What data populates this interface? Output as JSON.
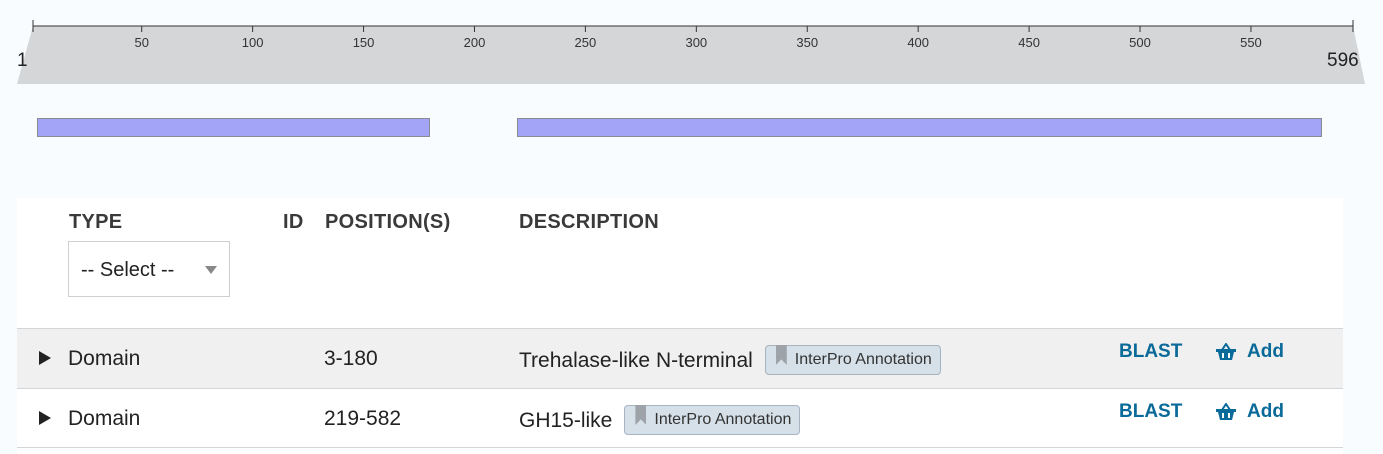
{
  "ruler": {
    "start": "1",
    "end": "596",
    "ticks": [
      "50",
      "100",
      "150",
      "200",
      "250",
      "300",
      "350",
      "400",
      "450",
      "500",
      "550"
    ]
  },
  "features": [
    {
      "start": 3,
      "end": 180
    },
    {
      "start": 219,
      "end": 582
    }
  ],
  "feature_color": "#a3a3f7",
  "table": {
    "headers": {
      "type": "TYPE",
      "id": "ID",
      "positions": "POSITION(S)",
      "description": "DESCRIPTION"
    },
    "type_filter": {
      "selected": "-- Select --"
    },
    "rows": [
      {
        "type": "Domain",
        "positions": "3-180",
        "description": "Trehalase-like N-terminal",
        "badge": "InterPro Annotation",
        "blast": "BLAST",
        "add": "Add"
      },
      {
        "type": "Domain",
        "positions": "219-582",
        "description": "GH15-like",
        "badge": "InterPro Annotation",
        "blast": "BLAST",
        "add": "Add"
      }
    ]
  },
  "colors": {
    "link": "#0a6a99",
    "badge_bg": "#d6e0e8",
    "ruler_fill": "#d4d6d8"
  },
  "icons": {
    "expand": "triangle-right-icon",
    "badge": "bookmark-icon",
    "add": "basket-icon"
  }
}
